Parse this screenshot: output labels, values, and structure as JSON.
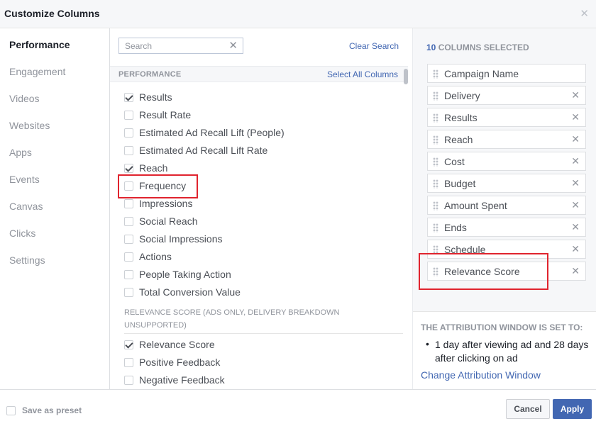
{
  "dialog": {
    "title": "Customize Columns"
  },
  "sidebar": {
    "items": [
      {
        "label": "Performance",
        "active": true
      },
      {
        "label": "Engagement"
      },
      {
        "label": "Videos"
      },
      {
        "label": "Websites"
      },
      {
        "label": "Apps"
      },
      {
        "label": "Events"
      },
      {
        "label": "Canvas"
      },
      {
        "label": "Clicks"
      },
      {
        "label": "Settings"
      }
    ]
  },
  "search": {
    "placeholder": "Search",
    "value": "",
    "clear_label": "Clear Search"
  },
  "performance_section": {
    "heading": "PERFORMANCE",
    "select_all_label": "Select All Columns",
    "options": [
      {
        "label": "Results",
        "checked": true
      },
      {
        "label": "Result Rate",
        "checked": false
      },
      {
        "label": "Estimated Ad Recall Lift (People)",
        "checked": false
      },
      {
        "label": "Estimated Ad Recall Lift Rate",
        "checked": false
      },
      {
        "label": "Reach",
        "checked": true
      },
      {
        "label": "Frequency",
        "checked": false
      },
      {
        "label": "Impressions",
        "checked": false
      },
      {
        "label": "Social Reach",
        "checked": false
      },
      {
        "label": "Social Impressions",
        "checked": false
      },
      {
        "label": "Actions",
        "checked": false
      },
      {
        "label": "People Taking Action",
        "checked": false
      },
      {
        "label": "Total Conversion Value",
        "checked": false
      }
    ]
  },
  "relevance_section": {
    "heading": "RELEVANCE SCORE (ADS ONLY, DELIVERY BREAKDOWN UNSUPPORTED)",
    "options": [
      {
        "label": "Relevance Score",
        "checked": true
      },
      {
        "label": "Positive Feedback",
        "checked": false
      },
      {
        "label": "Negative Feedback",
        "checked": false
      }
    ]
  },
  "selected": {
    "count": "10",
    "count_label": "COLUMNS SELECTED",
    "columns": [
      {
        "label": "Campaign Name",
        "removable": false
      },
      {
        "label": "Delivery",
        "removable": true
      },
      {
        "label": "Results",
        "removable": true
      },
      {
        "label": "Reach",
        "removable": true
      },
      {
        "label": "Cost",
        "removable": true
      },
      {
        "label": "Budget",
        "removable": true
      },
      {
        "label": "Amount Spent",
        "removable": true
      },
      {
        "label": "Ends",
        "removable": true
      },
      {
        "label": "Schedule",
        "removable": true
      },
      {
        "label": "Relevance Score",
        "removable": true
      }
    ]
  },
  "attribution": {
    "title": "THE ATTRIBUTION WINDOW IS SET TO:",
    "bullet_text": "1 day after viewing ad and 28 days after clicking on ad",
    "change_link": "Change Attribution Window"
  },
  "footer": {
    "save_preset_label": "Save as preset",
    "cancel_label": "Cancel",
    "apply_label": "Apply"
  },
  "colors": {
    "accent": "#4267b2",
    "highlight": "#e0242e",
    "panel_bg": "#f6f7f9"
  }
}
